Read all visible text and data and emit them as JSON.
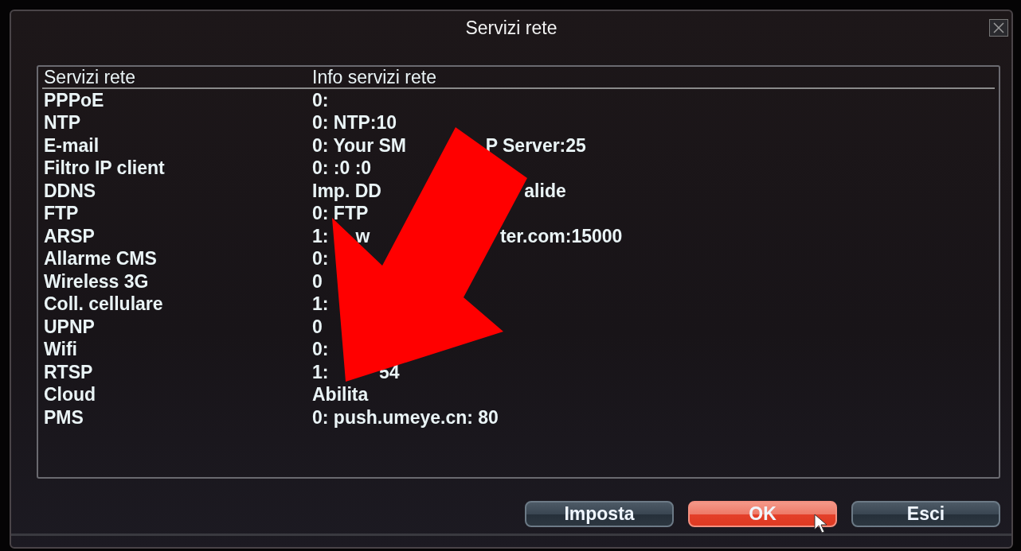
{
  "window": {
    "title": "Servizi rete"
  },
  "table": {
    "columns": [
      "Servizi rete",
      "Info servizi rete"
    ],
    "rows": [
      {
        "service": "PPPoE",
        "info": [
          "0:"
        ]
      },
      {
        "service": "NTP",
        "info": [
          "0: NTP:10"
        ]
      },
      {
        "service": "E-mail",
        "info": [
          "0: Your SM",
          "P Server:25"
        ]
      },
      {
        "service": "Filtro IP client",
        "info": [
          "0: :0 :0"
        ]
      },
      {
        "service": "DDNS",
        "info": [
          "Imp. DD",
          "alide"
        ]
      },
      {
        "service": "FTP",
        "info": [
          "0: FTP"
        ]
      },
      {
        "service": "ARSP",
        "info": [
          "1:",
          "w",
          "ter.com:15000"
        ]
      },
      {
        "service": "Allarme CMS",
        "info": [
          "0:"
        ]
      },
      {
        "service": "Wireless 3G",
        "info": [
          "0"
        ]
      },
      {
        "service": "Coll. cellulare",
        "info": [
          "1:"
        ]
      },
      {
        "service": "UPNP",
        "info": [
          "0"
        ]
      },
      {
        "service": "Wifi",
        "info": [
          "0:"
        ]
      },
      {
        "service": "RTSP",
        "info": [
          "1:",
          "54"
        ]
      },
      {
        "service": "Cloud",
        "info": [
          "Abilita"
        ]
      },
      {
        "service": "PMS",
        "info": [
          "0: push.umeye.cn: 80"
        ]
      }
    ]
  },
  "buttons": [
    {
      "label": "Imposta",
      "selected": false
    },
    {
      "label": "OK",
      "selected": true
    },
    {
      "label": "Esci",
      "selected": false
    }
  ]
}
